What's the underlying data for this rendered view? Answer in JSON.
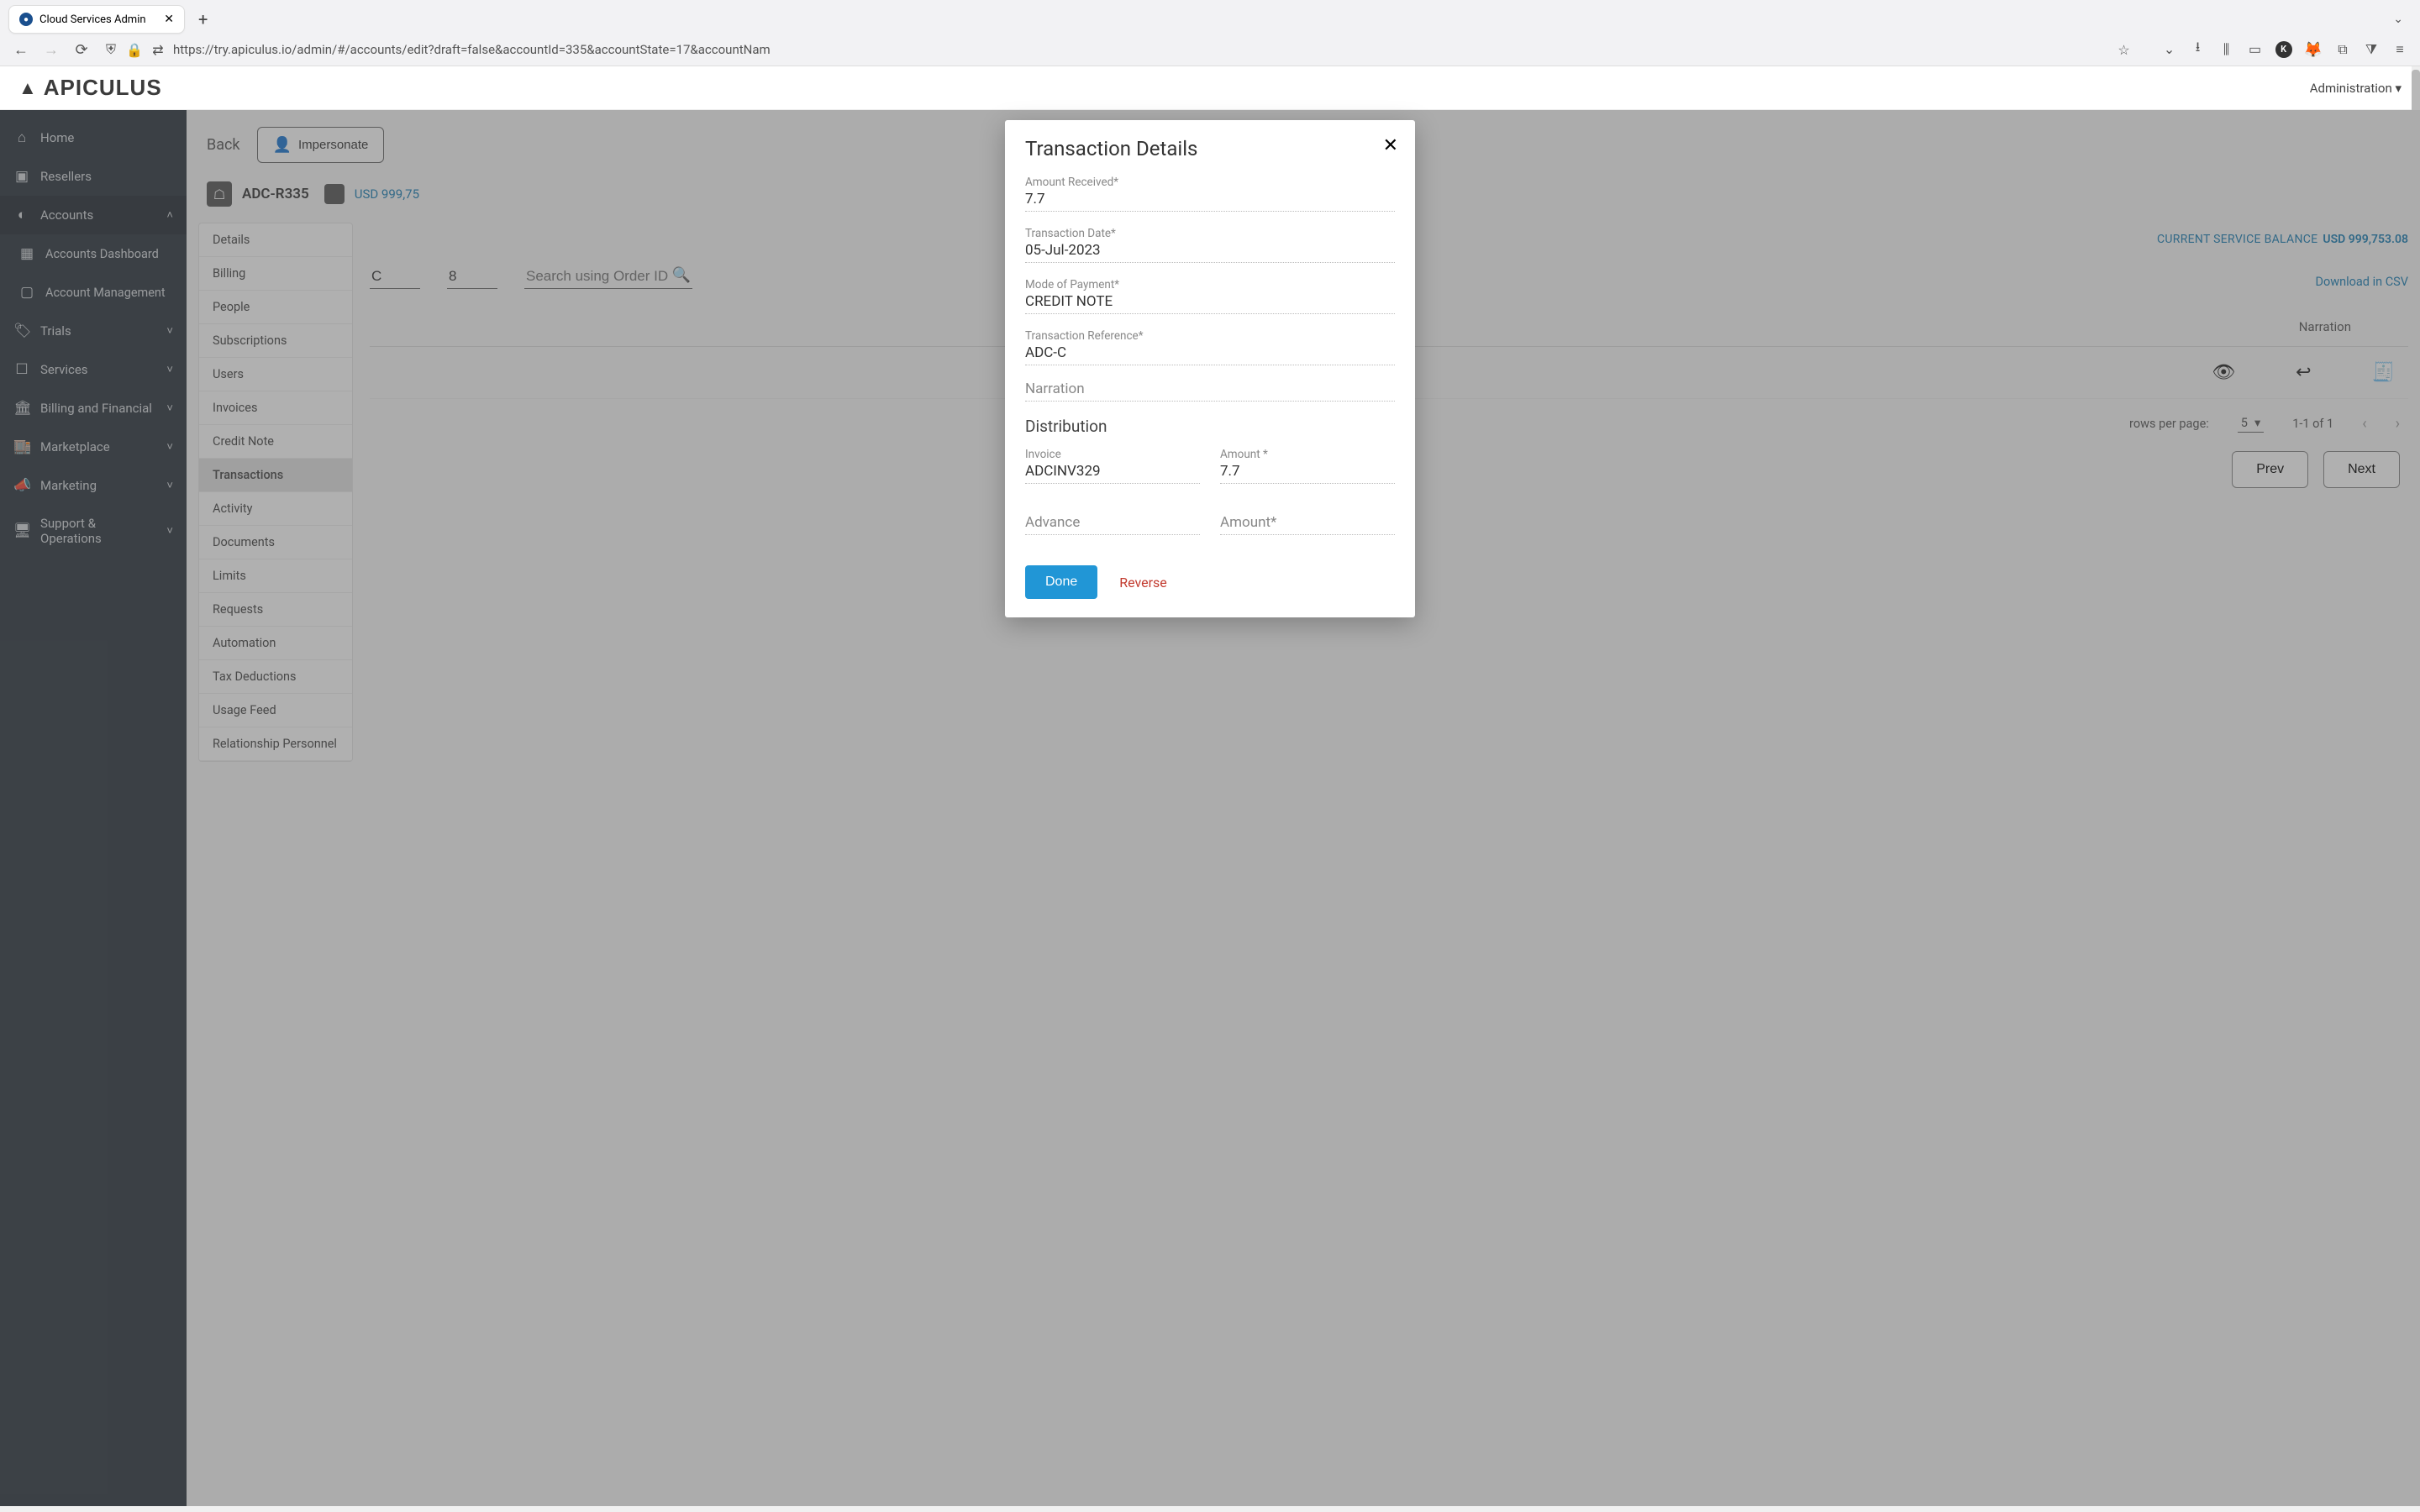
{
  "browser": {
    "tab_title": "Cloud Services Admin",
    "url_display": "https://try.apiculus.io/admin/#/accounts/edit?draft=false&accountId=335&accountState=17&accountNam",
    "url_host_bold": "apiculus.io"
  },
  "app": {
    "logo_text": "APICULUS",
    "admin_menu": "Administration"
  },
  "sidebar": {
    "items": [
      {
        "label": "Home",
        "icon": "⌂"
      },
      {
        "label": "Resellers",
        "icon": "▣"
      },
      {
        "label": "Accounts",
        "icon": "◐",
        "expanded": true,
        "active": true
      },
      {
        "label": "Accounts Dashboard",
        "icon": "▦",
        "sub": true
      },
      {
        "label": "Account Management",
        "icon": "▢",
        "sub": true
      },
      {
        "label": "Trials",
        "icon": "🏷",
        "exp": true
      },
      {
        "label": "Services",
        "icon": "☐",
        "exp": true
      },
      {
        "label": "Billing and Financial",
        "icon": "🏛",
        "exp": true
      },
      {
        "label": "Marketplace",
        "icon": "🏬",
        "exp": true
      },
      {
        "label": "Marketing",
        "icon": "📣",
        "exp": true
      },
      {
        "label": "Support & Operations",
        "icon": "🖥",
        "exp": true
      }
    ]
  },
  "page": {
    "back": "Back",
    "impersonate": "Impersonate",
    "account_id": "ADC-R335",
    "account_balance_short": "USD 999,75",
    "balance_label": "CURRENT SERVICE BALANCE",
    "balance_amount": "USD 999,753.08",
    "date_value": "8",
    "search_ph": "Search using Order ID",
    "download_csv": "Download in CSV",
    "col_narration": "Narration",
    "rows_per_page_label": "rows per page:",
    "rows_per_page_value": "5",
    "page_info": "1-1 of 1",
    "prev": "Prev",
    "next": "Next",
    "date_filter_partial": "C"
  },
  "vt_tabs": [
    "Details",
    "Billing",
    "People",
    "Subscriptions",
    "Users",
    "Invoices",
    "Credit Note",
    "Transactions",
    "Activity",
    "Documents",
    "Limits",
    "Requests",
    "Automation",
    "Tax Deductions",
    "Usage Feed",
    "Relationship Personnel"
  ],
  "modal": {
    "title": "Transaction Details",
    "fields": {
      "amount_received": {
        "label": "Amount Received*",
        "value": "7.7"
      },
      "transaction_date": {
        "label": "Transaction Date*",
        "value": "05-Jul-2023"
      },
      "mode_of_payment": {
        "label": "Mode of Payment*",
        "value": "CREDIT NOTE"
      },
      "transaction_ref": {
        "label": "Transaction Reference*",
        "value": "ADC-C"
      },
      "narration": {
        "label": "",
        "placeholder": "Narration",
        "value": ""
      }
    },
    "distribution_title": "Distribution",
    "distribution": {
      "invoice": {
        "label": "Invoice",
        "value": "ADCINV329"
      },
      "amount": {
        "label": "Amount *",
        "value": "7.7"
      },
      "advance": {
        "label": "",
        "placeholder": "Advance",
        "value": ""
      },
      "advance_amount": {
        "label": "",
        "placeholder": "Amount*",
        "value": ""
      }
    },
    "done": "Done",
    "reverse": "Reverse"
  }
}
